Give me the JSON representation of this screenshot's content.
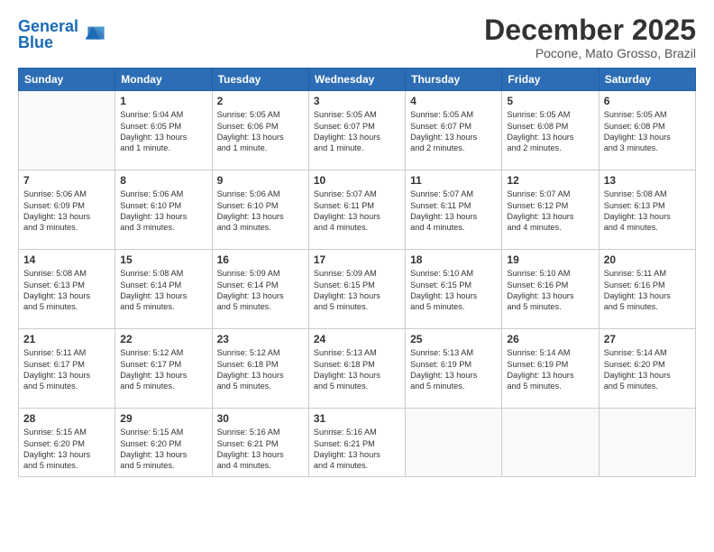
{
  "header": {
    "logo_general": "General",
    "logo_blue": "Blue",
    "month": "December 2025",
    "location": "Pocone, Mato Grosso, Brazil"
  },
  "days_of_week": [
    "Sunday",
    "Monday",
    "Tuesday",
    "Wednesday",
    "Thursday",
    "Friday",
    "Saturday"
  ],
  "weeks": [
    [
      {
        "day": "",
        "info": ""
      },
      {
        "day": "1",
        "info": "Sunrise: 5:04 AM\nSunset: 6:05 PM\nDaylight: 13 hours\nand 1 minute."
      },
      {
        "day": "2",
        "info": "Sunrise: 5:05 AM\nSunset: 6:06 PM\nDaylight: 13 hours\nand 1 minute."
      },
      {
        "day": "3",
        "info": "Sunrise: 5:05 AM\nSunset: 6:07 PM\nDaylight: 13 hours\nand 1 minute."
      },
      {
        "day": "4",
        "info": "Sunrise: 5:05 AM\nSunset: 6:07 PM\nDaylight: 13 hours\nand 2 minutes."
      },
      {
        "day": "5",
        "info": "Sunrise: 5:05 AM\nSunset: 6:08 PM\nDaylight: 13 hours\nand 2 minutes."
      },
      {
        "day": "6",
        "info": "Sunrise: 5:05 AM\nSunset: 6:08 PM\nDaylight: 13 hours\nand 3 minutes."
      }
    ],
    [
      {
        "day": "7",
        "info": "Sunrise: 5:06 AM\nSunset: 6:09 PM\nDaylight: 13 hours\nand 3 minutes."
      },
      {
        "day": "8",
        "info": "Sunrise: 5:06 AM\nSunset: 6:10 PM\nDaylight: 13 hours\nand 3 minutes."
      },
      {
        "day": "9",
        "info": "Sunrise: 5:06 AM\nSunset: 6:10 PM\nDaylight: 13 hours\nand 3 minutes."
      },
      {
        "day": "10",
        "info": "Sunrise: 5:07 AM\nSunset: 6:11 PM\nDaylight: 13 hours\nand 4 minutes."
      },
      {
        "day": "11",
        "info": "Sunrise: 5:07 AM\nSunset: 6:11 PM\nDaylight: 13 hours\nand 4 minutes."
      },
      {
        "day": "12",
        "info": "Sunrise: 5:07 AM\nSunset: 6:12 PM\nDaylight: 13 hours\nand 4 minutes."
      },
      {
        "day": "13",
        "info": "Sunrise: 5:08 AM\nSunset: 6:13 PM\nDaylight: 13 hours\nand 4 minutes."
      }
    ],
    [
      {
        "day": "14",
        "info": "Sunrise: 5:08 AM\nSunset: 6:13 PM\nDaylight: 13 hours\nand 5 minutes."
      },
      {
        "day": "15",
        "info": "Sunrise: 5:08 AM\nSunset: 6:14 PM\nDaylight: 13 hours\nand 5 minutes."
      },
      {
        "day": "16",
        "info": "Sunrise: 5:09 AM\nSunset: 6:14 PM\nDaylight: 13 hours\nand 5 minutes."
      },
      {
        "day": "17",
        "info": "Sunrise: 5:09 AM\nSunset: 6:15 PM\nDaylight: 13 hours\nand 5 minutes."
      },
      {
        "day": "18",
        "info": "Sunrise: 5:10 AM\nSunset: 6:15 PM\nDaylight: 13 hours\nand 5 minutes."
      },
      {
        "day": "19",
        "info": "Sunrise: 5:10 AM\nSunset: 6:16 PM\nDaylight: 13 hours\nand 5 minutes."
      },
      {
        "day": "20",
        "info": "Sunrise: 5:11 AM\nSunset: 6:16 PM\nDaylight: 13 hours\nand 5 minutes."
      }
    ],
    [
      {
        "day": "21",
        "info": "Sunrise: 5:11 AM\nSunset: 6:17 PM\nDaylight: 13 hours\nand 5 minutes."
      },
      {
        "day": "22",
        "info": "Sunrise: 5:12 AM\nSunset: 6:17 PM\nDaylight: 13 hours\nand 5 minutes."
      },
      {
        "day": "23",
        "info": "Sunrise: 5:12 AM\nSunset: 6:18 PM\nDaylight: 13 hours\nand 5 minutes."
      },
      {
        "day": "24",
        "info": "Sunrise: 5:13 AM\nSunset: 6:18 PM\nDaylight: 13 hours\nand 5 minutes."
      },
      {
        "day": "25",
        "info": "Sunrise: 5:13 AM\nSunset: 6:19 PM\nDaylight: 13 hours\nand 5 minutes."
      },
      {
        "day": "26",
        "info": "Sunrise: 5:14 AM\nSunset: 6:19 PM\nDaylight: 13 hours\nand 5 minutes."
      },
      {
        "day": "27",
        "info": "Sunrise: 5:14 AM\nSunset: 6:20 PM\nDaylight: 13 hours\nand 5 minutes."
      }
    ],
    [
      {
        "day": "28",
        "info": "Sunrise: 5:15 AM\nSunset: 6:20 PM\nDaylight: 13 hours\nand 5 minutes."
      },
      {
        "day": "29",
        "info": "Sunrise: 5:15 AM\nSunset: 6:20 PM\nDaylight: 13 hours\nand 5 minutes."
      },
      {
        "day": "30",
        "info": "Sunrise: 5:16 AM\nSunset: 6:21 PM\nDaylight: 13 hours\nand 4 minutes."
      },
      {
        "day": "31",
        "info": "Sunrise: 5:16 AM\nSunset: 6:21 PM\nDaylight: 13 hours\nand 4 minutes."
      },
      {
        "day": "",
        "info": ""
      },
      {
        "day": "",
        "info": ""
      },
      {
        "day": "",
        "info": ""
      }
    ]
  ]
}
